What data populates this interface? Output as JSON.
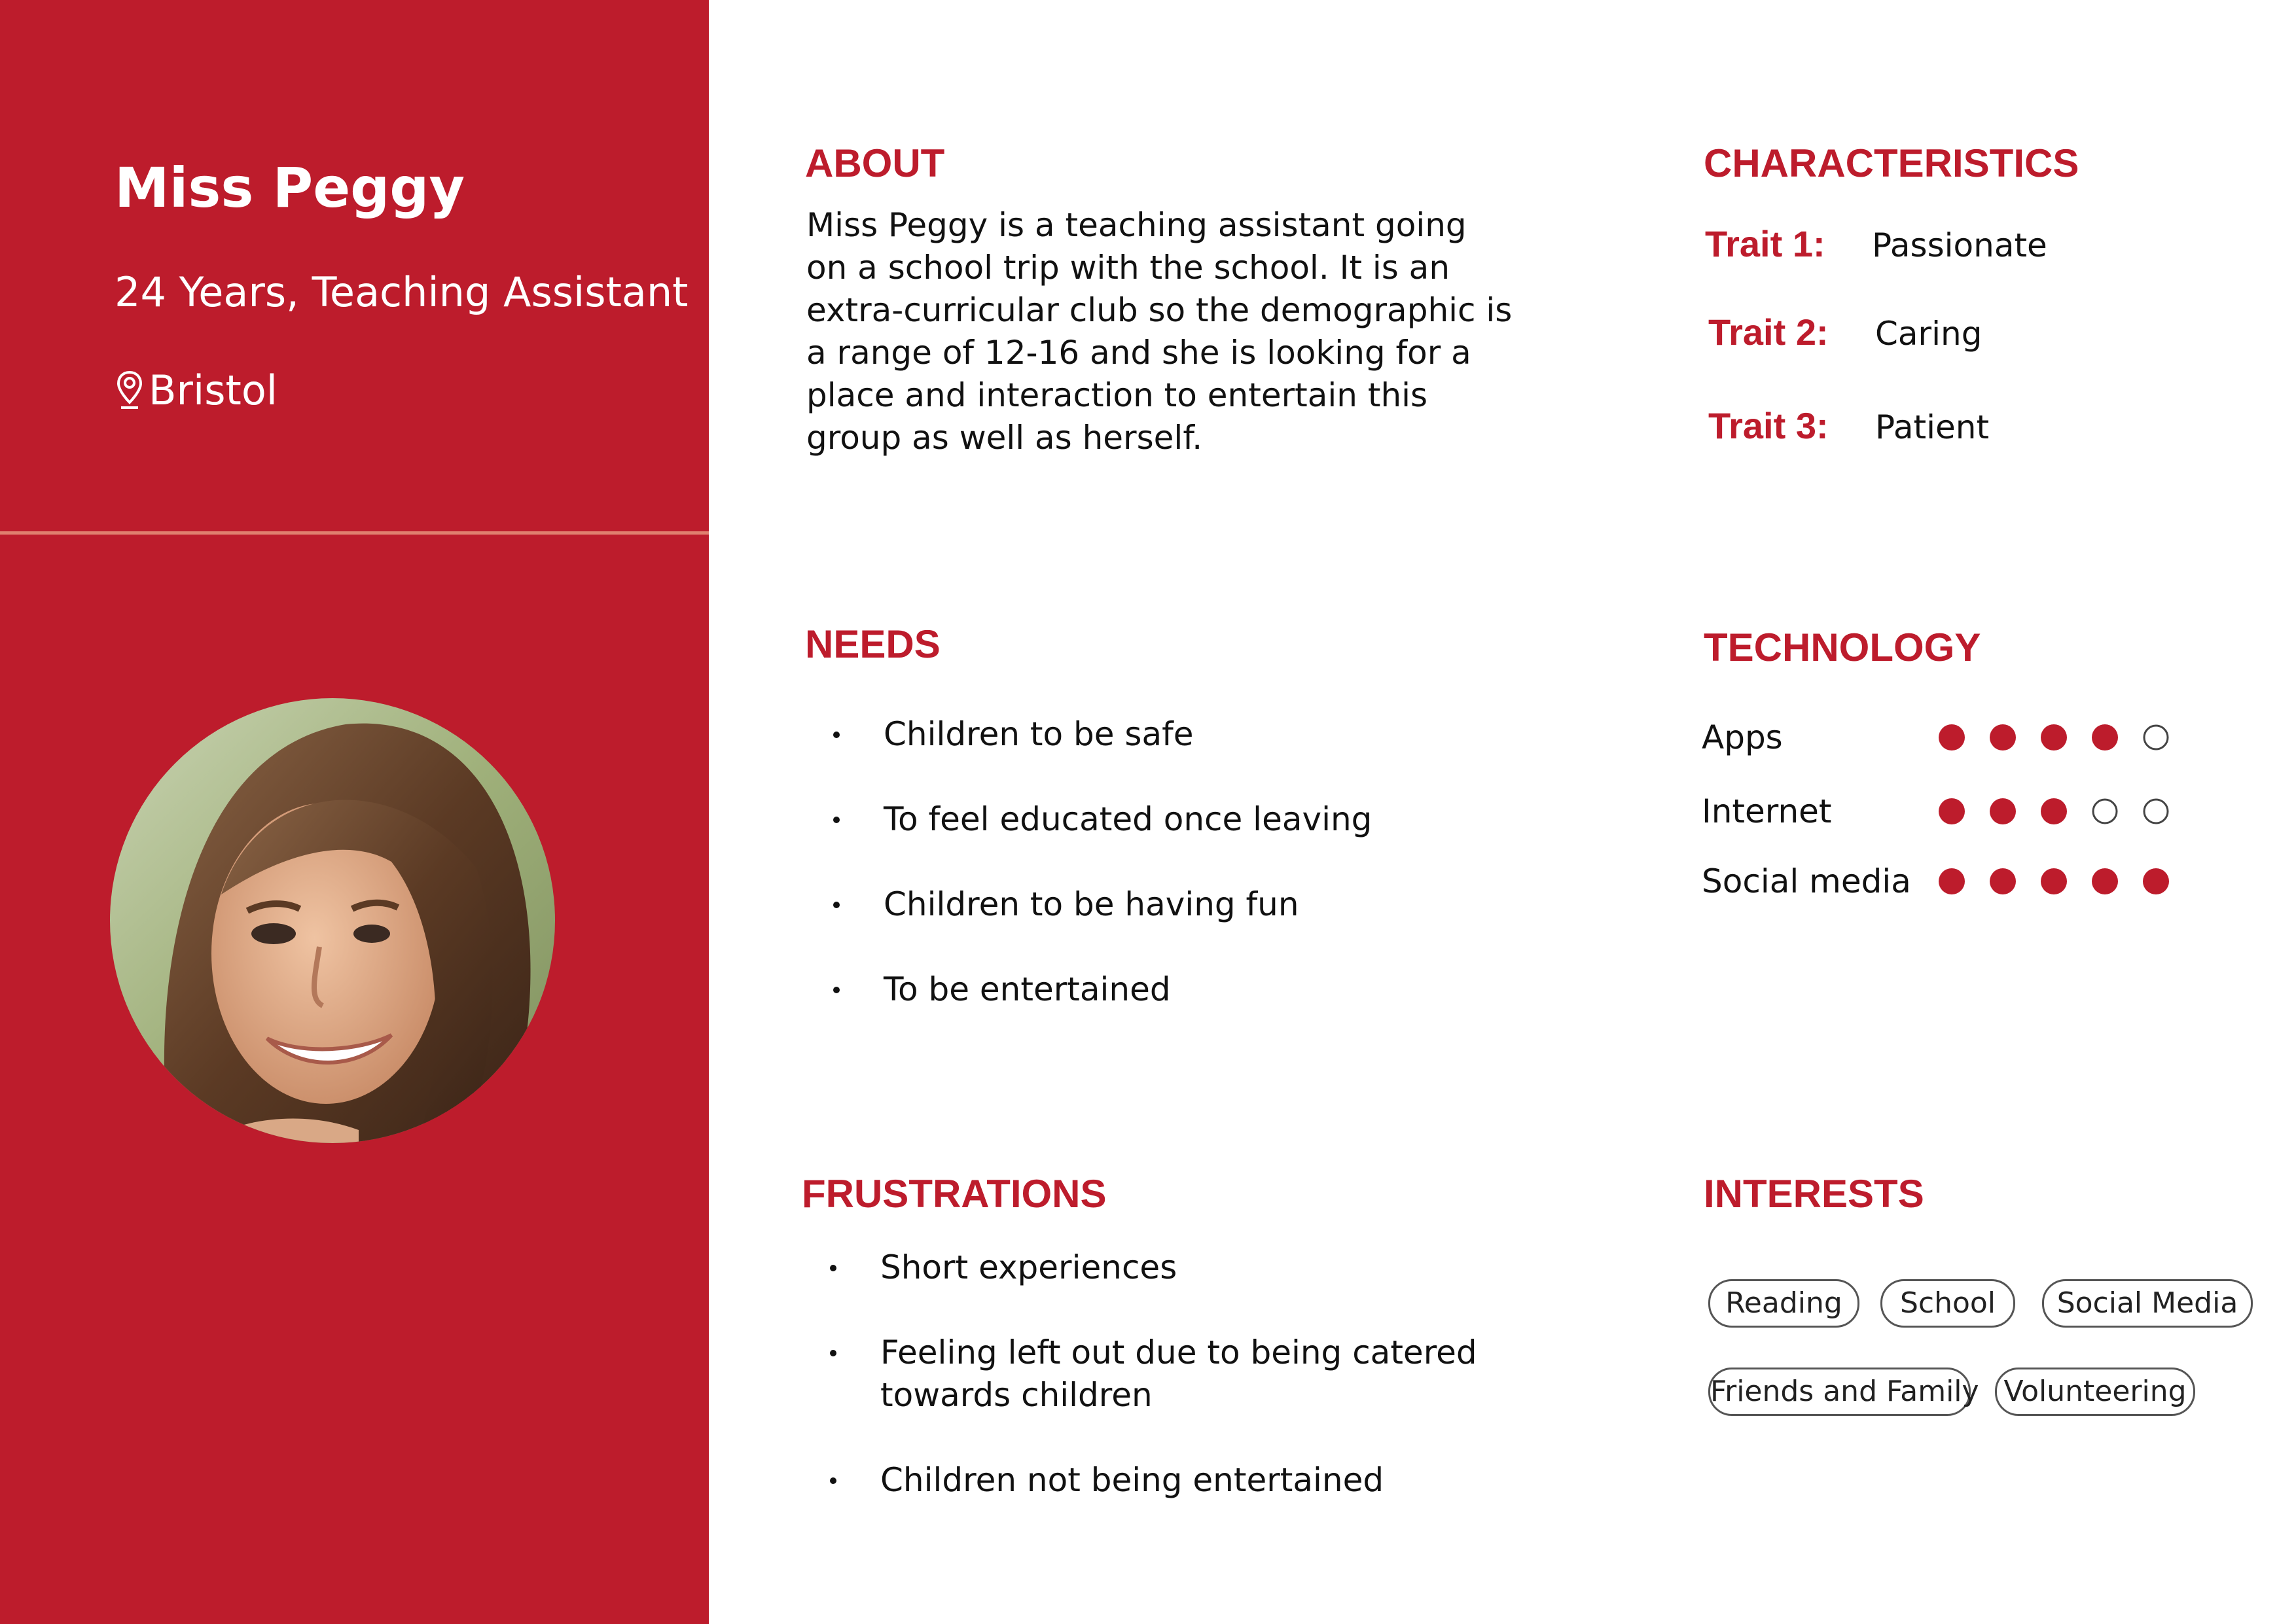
{
  "profile": {
    "name": "Miss Peggy",
    "subtitle": "24 Years, Teaching Assistant",
    "location": "Bristol",
    "location_icon": "map-pin-icon"
  },
  "about": {
    "heading": "ABOUT",
    "lines": [
      "Miss Peggy is a teaching assistant going",
      "on a school trip with the school. It is an",
      "extra-curricular club so the demographic is",
      "a range of 12-16 and she is looking for a",
      "place and interaction to entertain this",
      "group as well as herself."
    ]
  },
  "characteristics": {
    "heading": "CHARACTERISTICS",
    "traits": [
      {
        "label": "Trait 1:",
        "value": "Passionate"
      },
      {
        "label": "Trait 2:",
        "value": "Caring"
      },
      {
        "label": "Trait 3:",
        "value": "Patient"
      }
    ]
  },
  "needs": {
    "heading": "NEEDS",
    "items": [
      "Children to be safe",
      "To feel educated once leaving",
      "Children to be having fun",
      "To be entertained"
    ]
  },
  "technology": {
    "heading": "TECHNOLOGY",
    "max": 5,
    "rows": [
      {
        "label": "Apps",
        "level": 4
      },
      {
        "label": "Internet",
        "level": 3
      },
      {
        "label": "Social media",
        "level": 5
      }
    ]
  },
  "frustrations": {
    "heading": "FRUSTRATIONS",
    "items": [
      [
        "Short experiences"
      ],
      [
        "Feeling left out due to being catered",
        "towards children"
      ],
      [
        "Children not being entertained"
      ]
    ]
  },
  "interests": {
    "heading": "INTERESTS",
    "tags": [
      "Reading",
      "School",
      "Social Media",
      "Friends and Family",
      "Volunteering"
    ]
  },
  "colors": {
    "brand_red": "#bd1c2c",
    "divider": "#e0806f"
  }
}
